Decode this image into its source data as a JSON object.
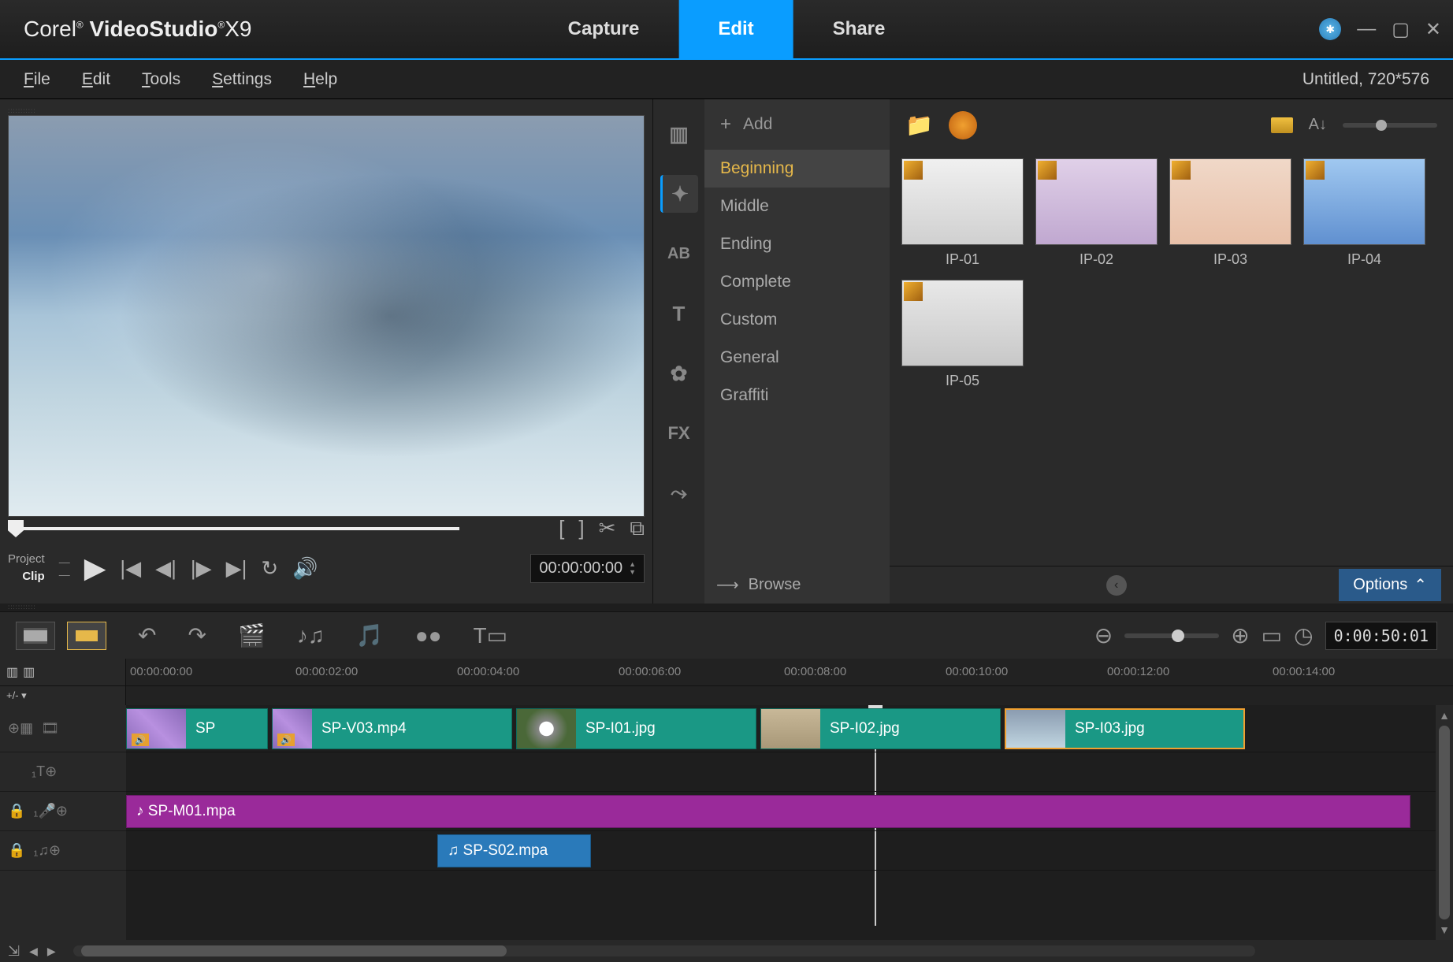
{
  "app": {
    "brand": "Corel",
    "name": "VideoStudio",
    "version": "X9"
  },
  "mainTabs": {
    "capture": "Capture",
    "edit": "Edit",
    "share": "Share"
  },
  "menu": {
    "file": "File",
    "edit": "Edit",
    "tools": "Tools",
    "settings": "Settings",
    "help": "Help"
  },
  "projectInfo": "Untitled, 720*576",
  "preview": {
    "projectLabel": "Project",
    "clipLabel": "Clip",
    "timecode": "00:00:00:00"
  },
  "library": {
    "addLabel": "Add",
    "categories": [
      "Beginning",
      "Middle",
      "Ending",
      "Complete",
      "Custom",
      "General",
      "Graffiti"
    ],
    "thumbs": [
      "IP-01",
      "IP-02",
      "IP-03",
      "IP-04",
      "IP-05"
    ],
    "browse": "Browse",
    "options": "Options"
  },
  "timeline": {
    "timecode": "0:00:50:01",
    "rulerMarks": [
      "00:00:00:00",
      "00:00:02:00",
      "00:00:04:00",
      "00:00:06:00",
      "00:00:08:00",
      "00:00:10:00",
      "00:00:12:00",
      "00:00:14:00"
    ],
    "clips": {
      "v1": "SP",
      "v2": "SP-V03.mp4",
      "v3": "SP-I01.jpg",
      "v4": "SP-I02.jpg",
      "v5": "SP-I03.jpg",
      "m1": "SP-M01.mpa",
      "s1": "SP-S02.mpa"
    }
  }
}
